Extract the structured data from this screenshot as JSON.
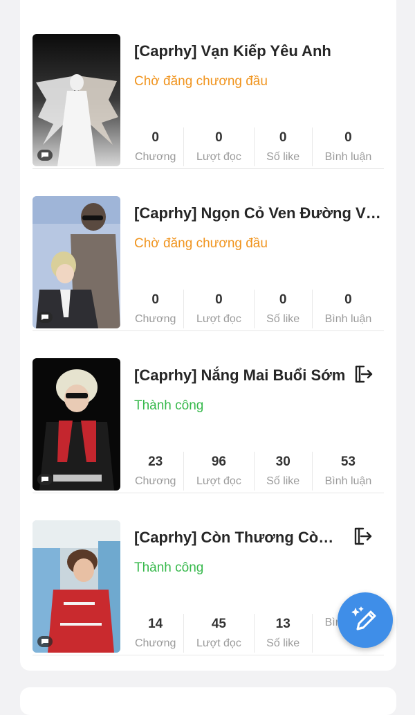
{
  "stat_labels": {
    "chapters": "Chương",
    "reads": "Lượt đọc",
    "likes": "Số like",
    "comments": "Bình luận"
  },
  "stories": [
    {
      "title": "[Caprhy] Vạn Kiếp Yêu Anh",
      "status": "Chờ đăng chương đầu",
      "status_color": "#f0941e",
      "stats": {
        "chapters": "0",
        "reads": "0",
        "likes": "0",
        "comments": "0"
      }
    },
    {
      "title": "[Caprhy] Ngọn Cỏ Ven Đường Và...",
      "status": "Chờ đăng chương đầu",
      "status_color": "#f0941e",
      "stats": {
        "chapters": "0",
        "reads": "0",
        "likes": "0",
        "comments": "0"
      }
    },
    {
      "title": "[Caprhy] Nắng Mai Buổi Sớm",
      "status": "Thành công",
      "status_color": "#35b84a",
      "stats": {
        "chapters": "23",
        "reads": "96",
        "likes": "30",
        "comments": "53"
      }
    },
    {
      "title": "[Caprhy] Còn Thương Còn ...",
      "status": "Thành công",
      "status_color": "#35b84a",
      "stats": {
        "chapters": "14",
        "reads": "45",
        "likes": "13",
        "comments": ""
      }
    }
  ],
  "icons": {
    "exit": "exit-icon",
    "chat": "chat-bubble-icon",
    "fab": "magic-pen-icon"
  },
  "colors": {
    "fab": "#3f8ee8",
    "pending": "#f0941e",
    "success": "#35b84a"
  }
}
